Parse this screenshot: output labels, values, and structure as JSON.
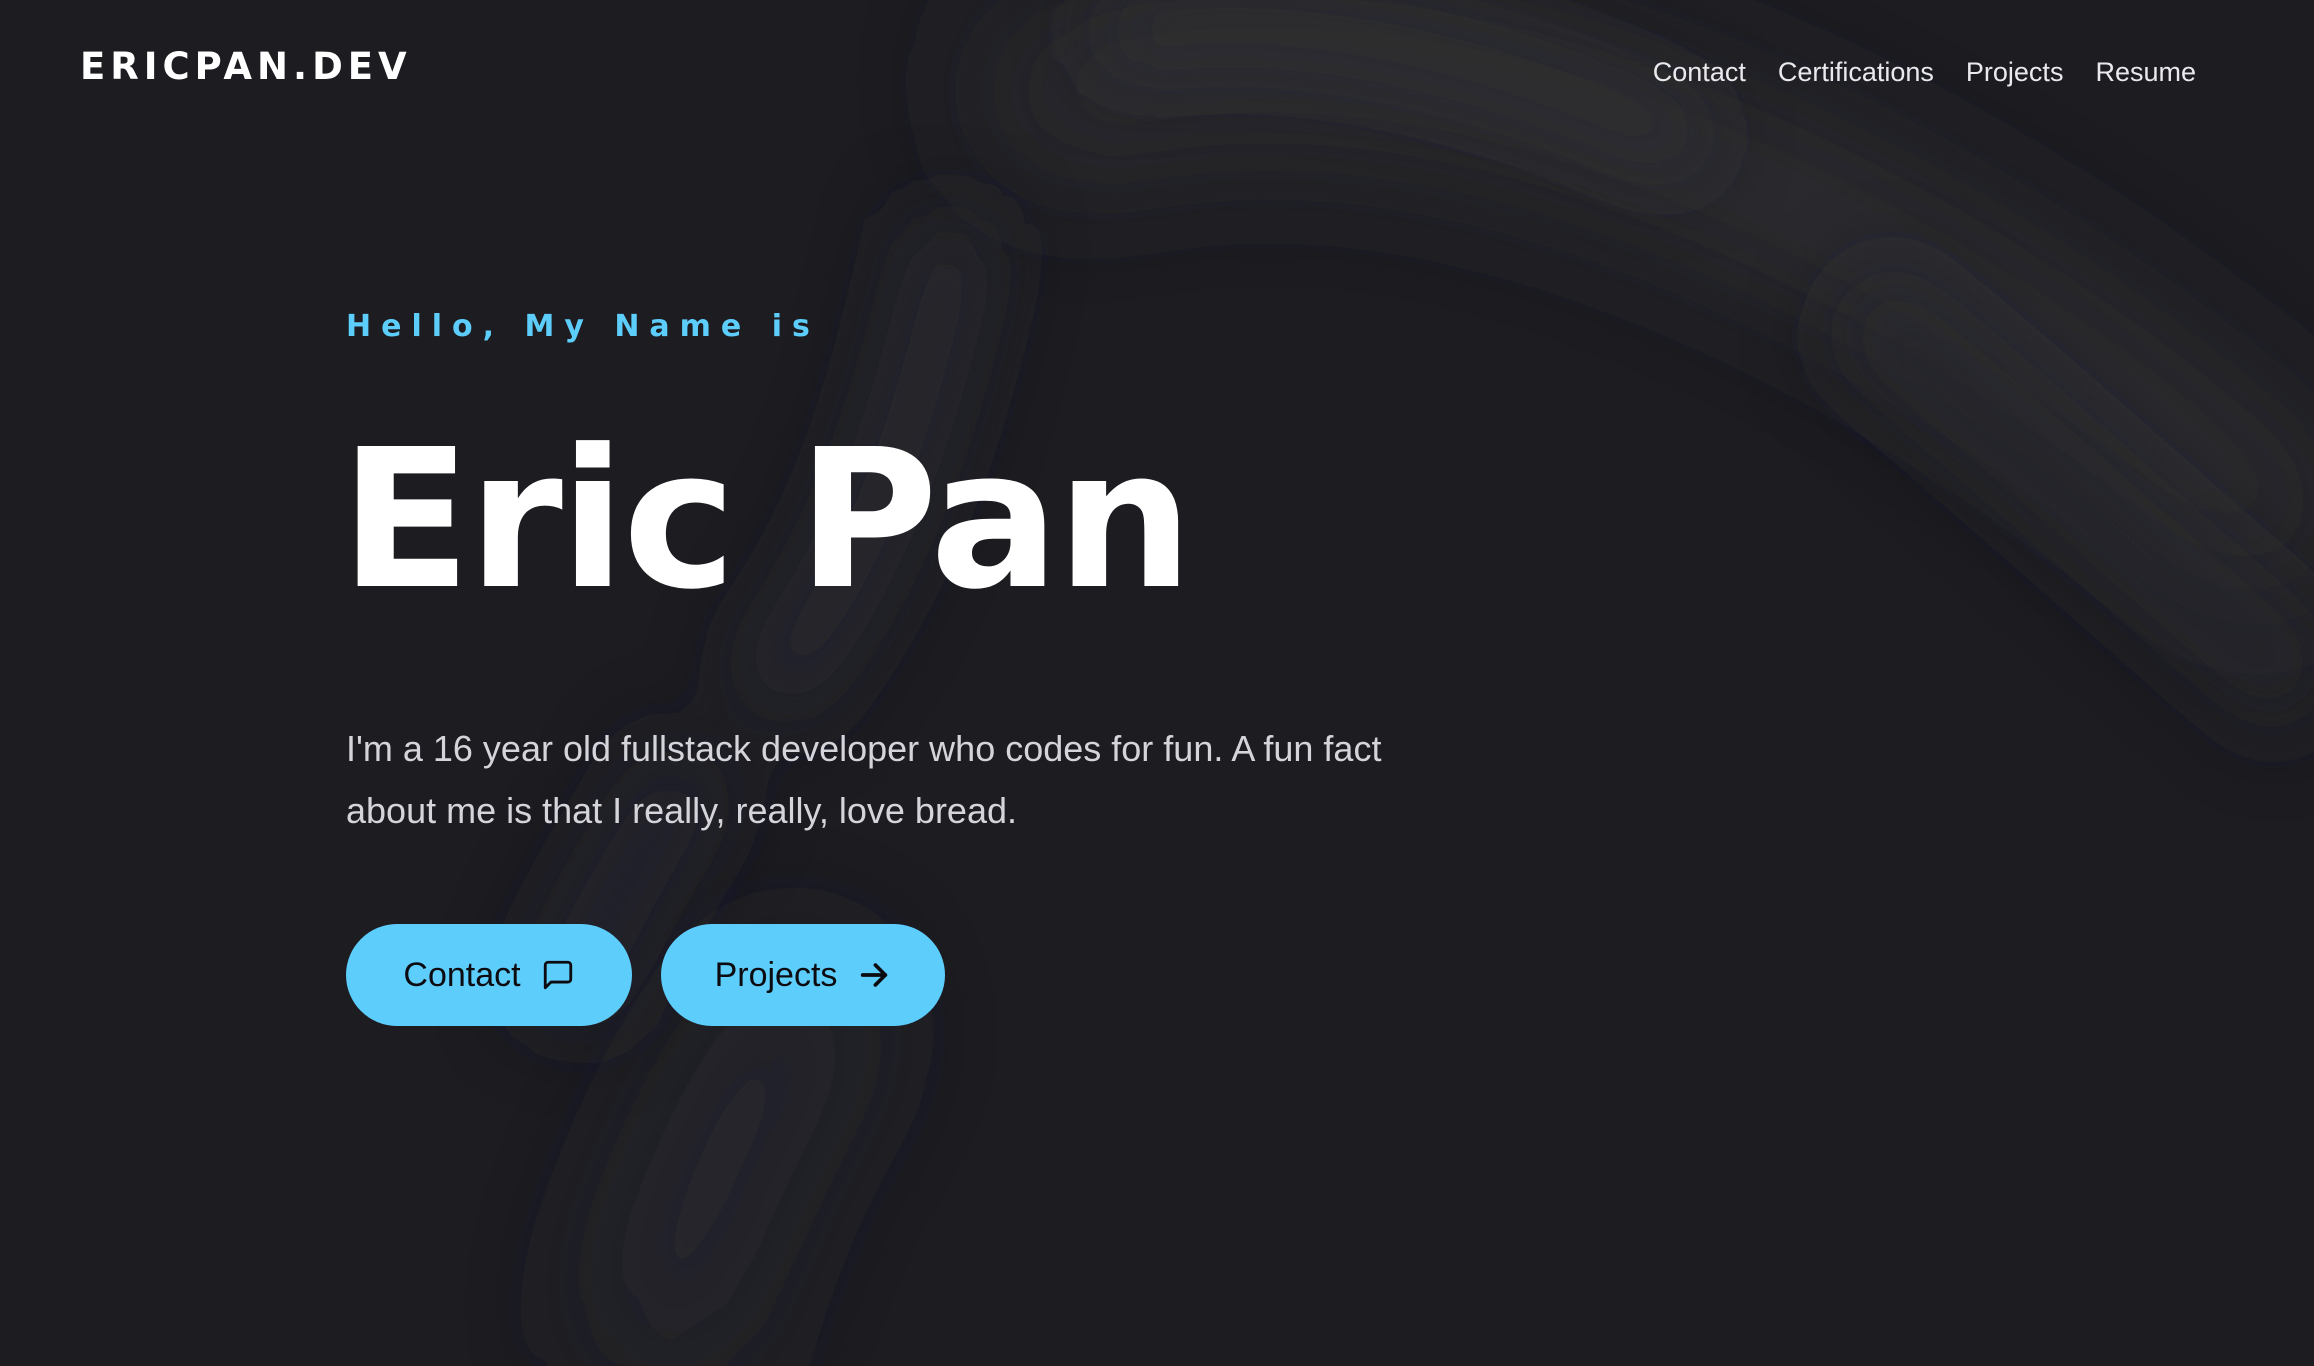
{
  "header": {
    "logo": "ERICPAN.DEV",
    "nav": [
      {
        "label": "Contact"
      },
      {
        "label": "Certifications"
      },
      {
        "label": "Projects"
      },
      {
        "label": "Resume"
      }
    ]
  },
  "hero": {
    "greeting": "Hello, My Name is",
    "name": "Eric Pan",
    "bio": "I'm a 16 year old fullstack developer who codes for fun. A fun fact about me is that I really, really, love bread.",
    "buttons": {
      "contact": {
        "label": "Contact",
        "icon": "message-square-icon"
      },
      "projects": {
        "label": "Projects",
        "icon": "arrow-right-icon"
      }
    }
  },
  "colors": {
    "background": "#1c1c21",
    "accent": "#5dcdfb",
    "text": "#ffffff",
    "muted_text": "#d4d4da",
    "button_text": "#0c0c10"
  }
}
